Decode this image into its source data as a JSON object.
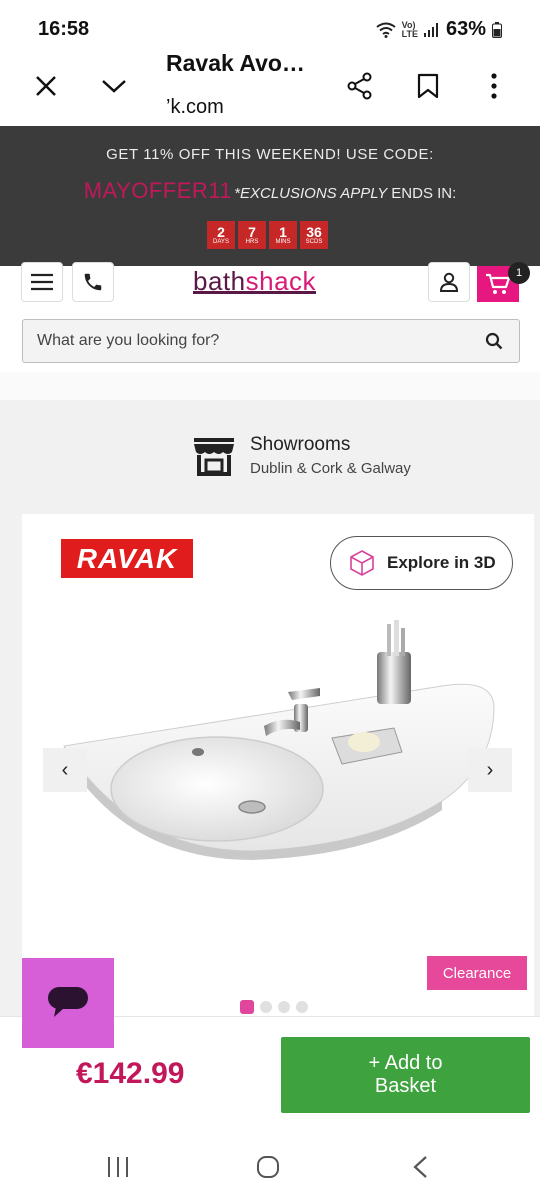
{
  "status": {
    "time": "16:58",
    "battery": "63%",
    "volte_top": "Vo)",
    "volte_bottom": "LTE"
  },
  "browser": {
    "title": "Ravak Avo…",
    "url": "’k.com"
  },
  "promo": {
    "line1": "GET 11% OFF THIS WEEKEND! USE CODE:",
    "code": "MAYOFFER11",
    "exclusions": "*EXCLUSIONS APPLY",
    "ends": "ENDS IN:",
    "timer": [
      {
        "value": "2",
        "unit": "DAYS"
      },
      {
        "value": "7",
        "unit": "HRS"
      },
      {
        "value": "1",
        "unit": "MINS"
      },
      {
        "value": "36",
        "unit": "SCDS"
      }
    ]
  },
  "header": {
    "logo_part1": "bath",
    "logo_part2": "shack",
    "cart_count": "1"
  },
  "search": {
    "placeholder": "What are you looking for?"
  },
  "showrooms": {
    "title": "Showrooms",
    "locations": "Dublin & Cork & Galway"
  },
  "product": {
    "brand": "RAVAK",
    "explore_label": "Explore in 3D",
    "badge": "Clearance",
    "prev": "‹",
    "next": "›",
    "image_count": 4,
    "image_index": 1,
    "price": "€142.99",
    "add_line1": "+ Add to",
    "add_line2": "Basket"
  },
  "colors": {
    "brand_pink": "#e6187f",
    "brand_plum": "#5a1846",
    "add_green": "#3ea23e",
    "promo_bg": "#3b3b3b",
    "timer_red": "#c62828"
  }
}
